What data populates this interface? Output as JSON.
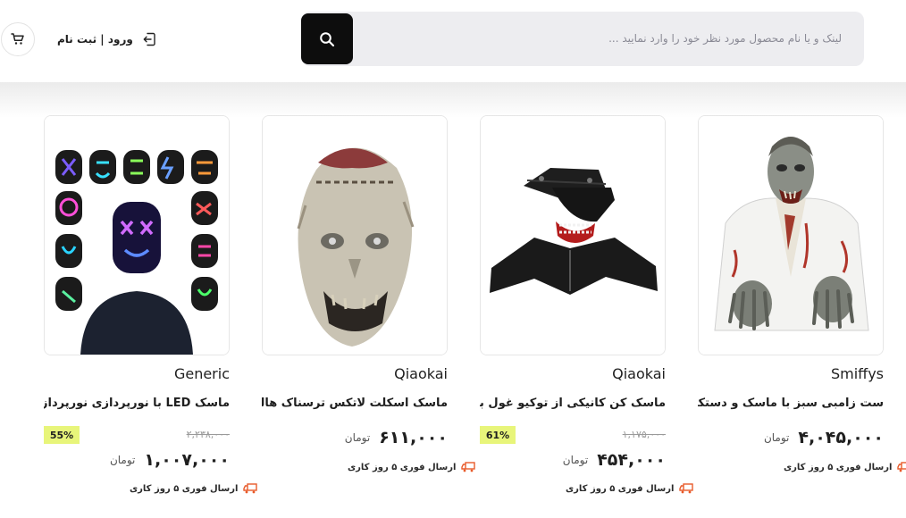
{
  "header": {
    "login_label": "ورود | ثبت نام",
    "search_placeholder": "لینک و یا نام محصول مورد نظر خود را وارد نمایید ...",
    "icons": {
      "cart": "cart-icon",
      "login": "login-icon",
      "search": "search-icon"
    }
  },
  "products": [
    {
      "brand": "Smiffys",
      "title": "ست زامبی سبز با ماسک و دستکش ...",
      "price": "۴,۰۴۵,۰۰۰",
      "currency": "تومان",
      "shipping": "ارسال فوری ۵ روز کاری",
      "image_icon": "zombie-costume-image"
    },
    {
      "brand": "Qiaokai",
      "title": "ماسک کن کانیکی از توکیو غول با چ...",
      "old_price": "۱,۱۷۵,۰۰۰",
      "discount": "61%",
      "price": "۴۵۴,۰۰۰",
      "currency": "تومان",
      "shipping": "ارسال فوری ۵ روز کاری",
      "image_icon": "kaneki-mask-image"
    },
    {
      "brand": "Qiaokai",
      "title": "ماسک اسکلت لاتکس ترسناک هالو...",
      "price": "۶۱۱,۰۰۰",
      "currency": "تومان",
      "shipping": "ارسال فوری ۵ روز کاری",
      "image_icon": "latex-horror-mask-image"
    },
    {
      "brand": "Generic",
      "title": "ماسک LED با نورپردازی نورپردازی نو...",
      "old_price": "۲,۲۳۸,۰۰۰",
      "discount": "55%",
      "price": "۱,۰۰۷,۰۰۰",
      "currency": "تومان",
      "shipping": "ارسال فوری ۵ روز کاری",
      "image_icon": "led-mask-image"
    }
  ],
  "colors": {
    "accent_badge": "#e8f57a",
    "search_button": "#0d0d0d",
    "shipping_icon": "#e85a2a"
  }
}
